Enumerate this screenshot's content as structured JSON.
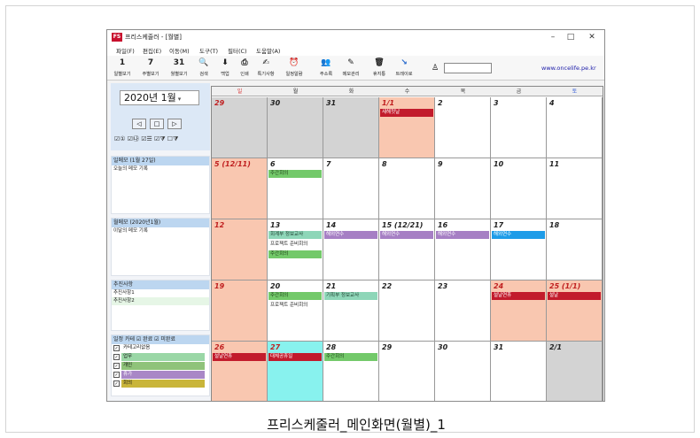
{
  "window": {
    "title": "프리스케줄러 - [월별]",
    "app_icon": "FS",
    "controls": {
      "minimize": "–",
      "maximize": "□",
      "close": "✕"
    }
  },
  "menu": [
    "파일(F)",
    "편집(E)",
    "이동(M)",
    "도구(T)",
    "필터(C)",
    "도움말(A)"
  ],
  "toolbar": [
    {
      "label": "일별보기",
      "glyph": "1"
    },
    {
      "label": "주별보기",
      "glyph": "7"
    },
    {
      "label": "월별보기",
      "glyph": "31"
    },
    {
      "label": "검색",
      "glyph": "🔍"
    },
    {
      "label": "백업",
      "glyph": "⬇"
    },
    {
      "label": "인쇄",
      "glyph": "⎙"
    },
    {
      "label": "특기사항",
      "glyph": "✍"
    },
    {
      "label": "일정알람",
      "glyph": "⏰"
    },
    {
      "label": "주소록",
      "glyph": "👥"
    },
    {
      "label": "메모관리",
      "glyph": "✎"
    },
    {
      "label": "휴지통",
      "glyph": "🗑"
    },
    {
      "label": "트레이로",
      "glyph": "↘"
    }
  ],
  "url": "www.oncelife.pe.kr",
  "sidebar": {
    "year_month": "2020년   1월",
    "nav": [
      "◁",
      "□",
      "▷"
    ],
    "filters": "☑① ☑㉯ ☑☰ ☑⧩ ☐⧩",
    "daily_memo": {
      "header": "일메모 (1월 27일)",
      "lines": [
        "오늘의 메모 기록"
      ]
    },
    "monthly_memo": {
      "header": "월메모 (2020년1월)",
      "lines": [
        "이달의 메모 기록"
      ]
    },
    "todo": {
      "header": "추진사항",
      "lines": [
        "추진사항1",
        "추진사항2"
      ]
    },
    "categories": {
      "header": "일정 카테  ☑ 완료 ☑ 미완료",
      "items": [
        {
          "label": "카테고리없음",
          "color": "#ffffff"
        },
        {
          "label": "업무",
          "color": "#9ad7a6"
        },
        {
          "label": "개인",
          "color": "#8fc37a"
        },
        {
          "label": "휴가",
          "color": "#a987c6"
        },
        {
          "label": "회의",
          "color": "#c9b53a"
        }
      ]
    }
  },
  "calendar": {
    "weekdays": [
      "일",
      "월",
      "화",
      "수",
      "목",
      "금",
      "토"
    ],
    "weekday_colors": [
      "#d63030",
      "#333333",
      "#333333",
      "#333333",
      "#333333",
      "#333333",
      "#2f59d6"
    ],
    "weeks": [
      [
        {
          "day": "29",
          "bg": "#d3d3d3",
          "color": "#c02020",
          "events": []
        },
        {
          "day": "30",
          "bg": "#d3d3d3",
          "color": "#222222",
          "events": []
        },
        {
          "day": "31",
          "bg": "#d3d3d3",
          "color": "#222222",
          "events": []
        },
        {
          "day": "1/1",
          "bg": "#f9c7b0",
          "color": "#c02020",
          "events": [
            {
              "text": "새해첫날",
              "color": "#c21b2c",
              "text_color": "#ffffff"
            }
          ]
        },
        {
          "day": "2",
          "bg": "#ffffff",
          "color": "#222222",
          "events": []
        },
        {
          "day": "3",
          "bg": "#ffffff",
          "color": "#222222",
          "events": []
        },
        {
          "day": "4",
          "bg": "#ffffff",
          "color": "#222222",
          "events": []
        }
      ],
      [
        {
          "day": "5   (12/11)",
          "bg": "#f9c7b0",
          "color": "#c02020",
          "events": []
        },
        {
          "day": "6",
          "bg": "#ffffff",
          "color": "#222222",
          "events": [
            {
              "text": "주간회의",
              "color": "#73c96a",
              "text_color": "#1b3a15"
            }
          ]
        },
        {
          "day": "7",
          "bg": "#ffffff",
          "color": "#222222",
          "events": []
        },
        {
          "day": "8",
          "bg": "#ffffff",
          "color": "#222222",
          "events": []
        },
        {
          "day": "9",
          "bg": "#ffffff",
          "color": "#222222",
          "events": []
        },
        {
          "day": "10",
          "bg": "#ffffff",
          "color": "#222222",
          "events": []
        },
        {
          "day": "11",
          "bg": "#ffffff",
          "color": "#222222",
          "events": []
        }
      ],
      [
        {
          "day": "12",
          "bg": "#f9c7b0",
          "color": "#c02020",
          "events": []
        },
        {
          "day": "13",
          "bg": "#ffffff",
          "color": "#222222",
          "events": [
            {
              "text": "회계부 정보교사",
              "color": "#8ed6b8",
              "text_color": "#1b3a2a"
            },
            {
              "text": "프로젝트 준비회의",
              "color": "#ffffff",
              "text_color": "#222222"
            },
            {
              "text": "주간회의",
              "color": "#73c96a",
              "text_color": "#1b3a15"
            }
          ]
        },
        {
          "day": "14",
          "bg": "#ffffff",
          "color": "#222222",
          "events": [
            {
              "text": "해외연수",
              "color": "#a67fc4",
              "text_color": "#ffffff"
            }
          ]
        },
        {
          "day": "15   (12/21)",
          "bg": "#ffffff",
          "color": "#222222",
          "events": [
            {
              "text": "해외연수",
              "color": "#a67fc4",
              "text_color": "#ffffff"
            }
          ]
        },
        {
          "day": "16",
          "bg": "#ffffff",
          "color": "#222222",
          "events": [
            {
              "text": "해외연수",
              "color": "#a67fc4",
              "text_color": "#ffffff"
            }
          ]
        },
        {
          "day": "17",
          "bg": "#ffffff",
          "color": "#222222",
          "events": [
            {
              "text": "해외연수",
              "color": "#1e9ce8",
              "text_color": "#ffffff"
            }
          ]
        },
        {
          "day": "18",
          "bg": "#ffffff",
          "color": "#222222",
          "events": []
        }
      ],
      [
        {
          "day": "19",
          "bg": "#f9c7b0",
          "color": "#c02020",
          "events": []
        },
        {
          "day": "20",
          "bg": "#ffffff",
          "color": "#222222",
          "events": [
            {
              "text": "주간회의",
              "color": "#73c96a",
              "text_color": "#1b3a15"
            },
            {
              "text": "프로젝트 준비회의",
              "color": "#ffffff",
              "text_color": "#222222"
            }
          ]
        },
        {
          "day": "21",
          "bg": "#ffffff",
          "color": "#222222",
          "events": [
            {
              "text": "기획부 정보교사",
              "color": "#8ed6b8",
              "text_color": "#1b3a2a"
            }
          ]
        },
        {
          "day": "22",
          "bg": "#ffffff",
          "color": "#222222",
          "events": []
        },
        {
          "day": "23",
          "bg": "#ffffff",
          "color": "#222222",
          "events": []
        },
        {
          "day": "24",
          "bg": "#f9c7b0",
          "color": "#c02020",
          "events": [
            {
              "text": "설날연휴",
              "color": "#c21b2c",
              "text_color": "#ffffff"
            }
          ]
        },
        {
          "day": "25   (1/1)",
          "bg": "#f9c7b0",
          "color": "#c02020",
          "events": [
            {
              "text": "설날",
              "color": "#c21b2c",
              "text_color": "#ffffff"
            }
          ]
        }
      ],
      [
        {
          "day": "26",
          "bg": "#f9c7b0",
          "color": "#c02020",
          "events": [
            {
              "text": "설날연휴",
              "color": "#c21b2c",
              "text_color": "#ffffff"
            }
          ]
        },
        {
          "day": "27",
          "bg": "#88f2ee",
          "color": "#c02020",
          "events": [
            {
              "text": "대체공휴일",
              "color": "#c21b2c",
              "text_color": "#ffffff"
            }
          ]
        },
        {
          "day": "28",
          "bg": "#ffffff",
          "color": "#222222",
          "events": [
            {
              "text": "주간회의",
              "color": "#73c96a",
              "text_color": "#1b3a15"
            }
          ]
        },
        {
          "day": "29",
          "bg": "#ffffff",
          "color": "#222222",
          "events": []
        },
        {
          "day": "30",
          "bg": "#ffffff",
          "color": "#222222",
          "events": []
        },
        {
          "day": "31",
          "bg": "#ffffff",
          "color": "#222222",
          "events": []
        },
        {
          "day": "2/1",
          "bg": "#d3d3d3",
          "color": "#222222",
          "events": []
        }
      ]
    ]
  },
  "caption": "프리스케줄러_메인화면(월별)_1"
}
